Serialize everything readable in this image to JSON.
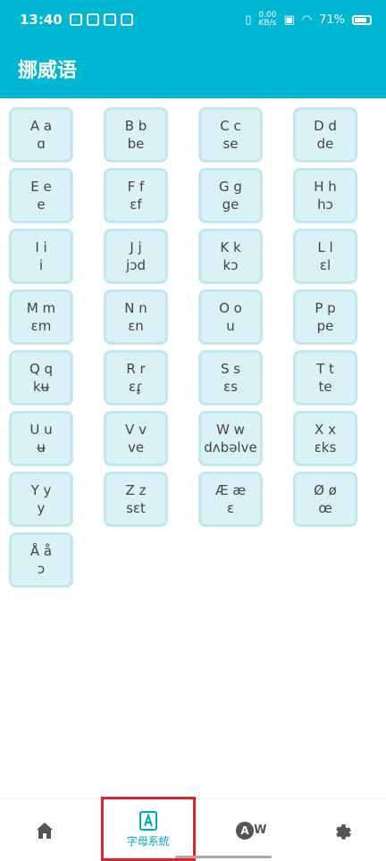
{
  "status_bar": {
    "time": "13:40",
    "net_speed_value": "0.00",
    "net_speed_unit": "KB/s",
    "battery": "71%"
  },
  "app": {
    "title": "挪威语"
  },
  "letters": [
    {
      "letter": "A a",
      "ipa": "ɑ"
    },
    {
      "letter": "B b",
      "ipa": "be"
    },
    {
      "letter": "C c",
      "ipa": "se"
    },
    {
      "letter": "D d",
      "ipa": "de"
    },
    {
      "letter": "E e",
      "ipa": "e"
    },
    {
      "letter": "F f",
      "ipa": "ɛf"
    },
    {
      "letter": "G g",
      "ipa": "ge"
    },
    {
      "letter": "H h",
      "ipa": "hɔ"
    },
    {
      "letter": "I i",
      "ipa": "i"
    },
    {
      "letter": "J j",
      "ipa": "jɔd"
    },
    {
      "letter": "K k",
      "ipa": "kɔ"
    },
    {
      "letter": "L l",
      "ipa": "ɛl"
    },
    {
      "letter": "M m",
      "ipa": "ɛm"
    },
    {
      "letter": "N n",
      "ipa": "ɛn"
    },
    {
      "letter": "O o",
      "ipa": "u"
    },
    {
      "letter": "P p",
      "ipa": "pe"
    },
    {
      "letter": "Q q",
      "ipa": "kʉ"
    },
    {
      "letter": "R r",
      "ipa": "ɛɾ̥"
    },
    {
      "letter": "S s",
      "ipa": "ɛs"
    },
    {
      "letter": "T t",
      "ipa": "te"
    },
    {
      "letter": "U u",
      "ipa": "ʉ"
    },
    {
      "letter": "V v",
      "ipa": "ve"
    },
    {
      "letter": "W w",
      "ipa": "dʌbəlve"
    },
    {
      "letter": "X x",
      "ipa": "ɛks"
    },
    {
      "letter": "Y y",
      "ipa": "y"
    },
    {
      "letter": "Z z",
      "ipa": "sɛt"
    },
    {
      "letter": "Æ æ",
      "ipa": "ɛ"
    },
    {
      "letter": "Ø ø",
      "ipa": "œ"
    },
    {
      "letter": "Å å",
      "ipa": "ɔ"
    }
  ],
  "bottom_nav": {
    "items": [
      {
        "icon": "home-icon",
        "label": ""
      },
      {
        "icon": "alphabet-icon",
        "label": "字母系統"
      },
      {
        "icon": "words-icon",
        "label": ""
      },
      {
        "icon": "settings-icon",
        "label": ""
      }
    ],
    "aw_letters": "W",
    "aw_circle": "A"
  },
  "colors": {
    "primary": "#00B7D3",
    "cell_bg": "#DAF2F5",
    "cell_border": "#BFE9EE",
    "active": "#00A7C2",
    "highlight": "#E0202A"
  }
}
